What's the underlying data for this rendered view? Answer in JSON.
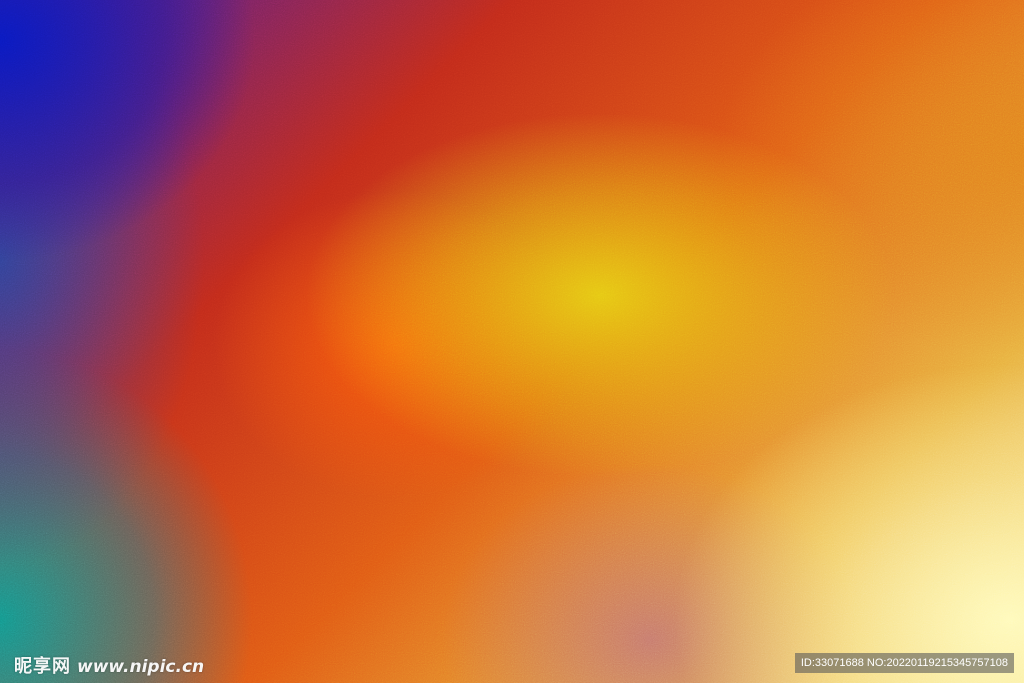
{
  "watermark": {
    "brand": "昵享网",
    "url": "www.nipic.cn",
    "id_text": "ID:33071688 NO:20220119215345757108"
  },
  "colors": {
    "top_left": "#1020c0",
    "center_glow": "#e6cd14",
    "orange_glow": "#ff5a0a",
    "bottom_right": "#fffab9",
    "bottom_left": "#149690"
  }
}
